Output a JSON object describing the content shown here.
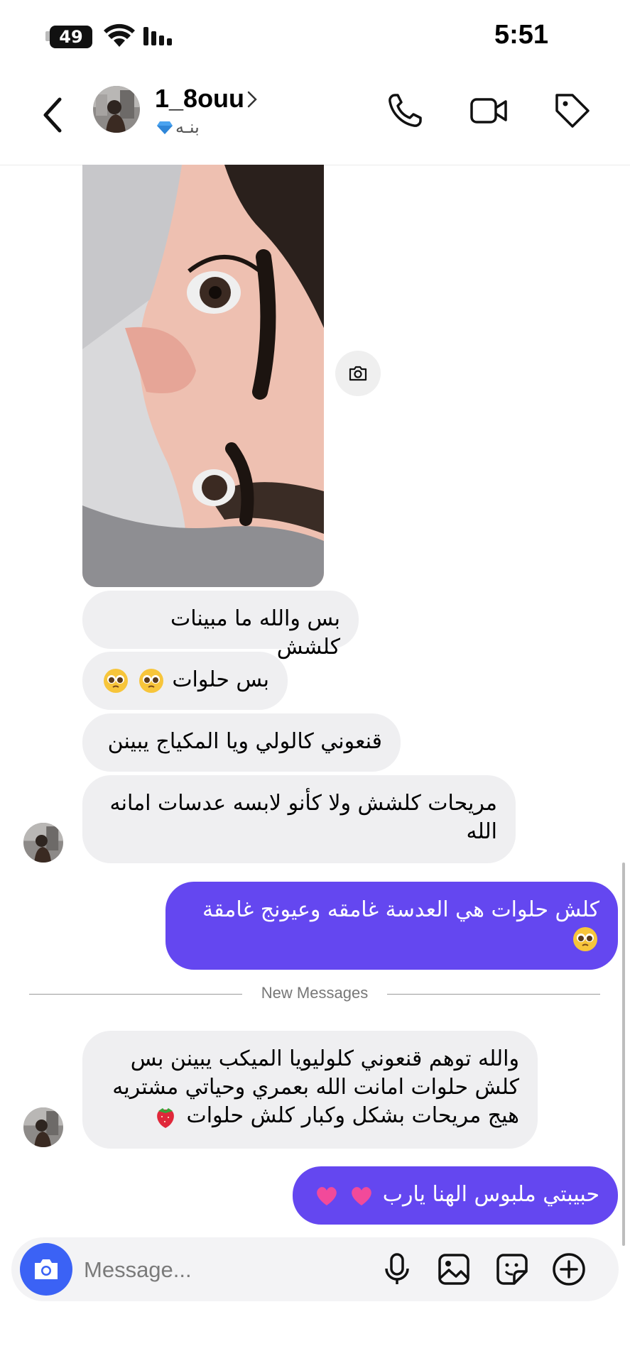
{
  "status_bar": {
    "battery": "49",
    "time": "5:51"
  },
  "header": {
    "username": "1_8ouu",
    "subtitle": "بنـه",
    "icons": [
      "back-chevron-icon",
      "phone-icon",
      "video-camera-icon",
      "tag-icon"
    ]
  },
  "messages": [
    {
      "type": "photo",
      "from": "them"
    },
    {
      "from": "them",
      "text": "بس والله ما مبينات كلشش"
    },
    {
      "from": "them",
      "text": "بس حلوات",
      "emoji": [
        "pleading-face",
        "pleading-face"
      ]
    },
    {
      "from": "them",
      "text": "قنعوني كالولي ويا المكياج يبينن"
    },
    {
      "from": "them",
      "text": "مريحات كلشش ولا كأنو لابسه عدسات امانه الله"
    },
    {
      "from": "me",
      "text": "كلش حلوات هي العدسة غامقه وعيونج غامقة",
      "emoji": [
        "pleading-face"
      ]
    },
    {
      "from": "them",
      "text": "والله توهم قنعوني كلوليويا الميكب يبينن بس كلش حلوات امانت الله بعمري وحياتي مشتريه هيج مريحات بشكل وكبار كلش حلوات",
      "emoji": [
        "strawberry"
      ]
    },
    {
      "from": "me",
      "text": "حبيبتي ملبوس الهنا يارب",
      "emoji": [
        "pink-heart",
        "pink-heart"
      ]
    }
  ],
  "divider": {
    "label": "New Messages"
  },
  "composer": {
    "placeholder": "Message...",
    "icons": [
      "camera-icon",
      "microphone-icon",
      "gallery-icon",
      "sticker-icon",
      "plus-icon"
    ]
  },
  "colors": {
    "outgoing_bubble": "#6447f0",
    "incoming_bubble": "#efeff1",
    "camera_button": "#3b62f5"
  }
}
